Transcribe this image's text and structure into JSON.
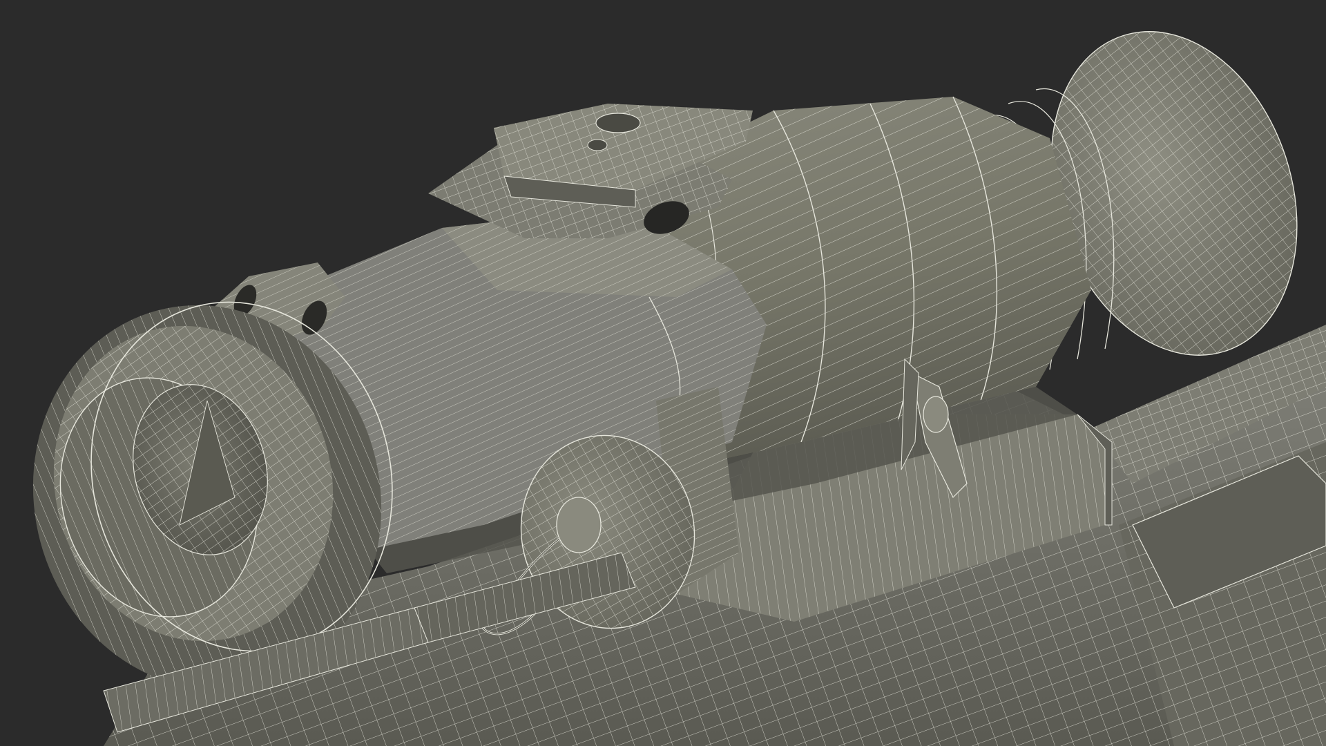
{
  "scene": {
    "subject": "wireframe-scope-on-rail",
    "colors": {
      "background": "#2b2b2b",
      "surface_light": "#8a8a7e",
      "surface_mid": "#75756a",
      "surface_dark": "#5c5c53",
      "surface_shadow": "#46463f",
      "wire": "#e6e6dc",
      "hole": "#262624"
    }
  }
}
